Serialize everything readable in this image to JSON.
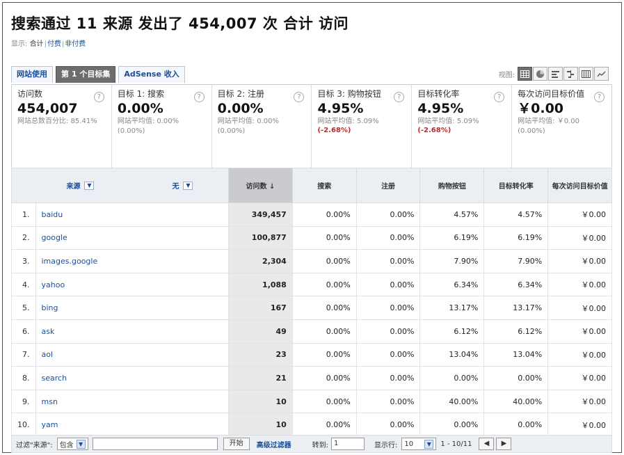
{
  "header": {
    "title": "搜索通过 11 来源 发出了 454,007 次 合计 访问",
    "show_label": "显示:",
    "show_options": [
      "合计",
      "付费",
      "非付费"
    ]
  },
  "tabs": [
    "网站使用",
    "第 1 个目标集",
    "AdSense 收入"
  ],
  "views": {
    "label": "视图:",
    "icons": [
      "table-view-icon",
      "pie-view-icon",
      "performance-view-icon",
      "comparison-view-icon",
      "pivot-view-icon",
      "trend-view-icon"
    ]
  },
  "metrics": [
    {
      "label": "访问数",
      "value": "454,007",
      "sub": "网站总数百分比: 85.41%",
      "neg": ""
    },
    {
      "label": "目标 1: 搜索",
      "value": "0.00%",
      "sub": "网站平均值: 0.00% (0.00%)",
      "neg": ""
    },
    {
      "label": "目标 2: 注册",
      "value": "0.00%",
      "sub": "网站平均值: 0.00% (0.00%)",
      "neg": ""
    },
    {
      "label": "目标 3: 购物按钮",
      "value": "4.95%",
      "sub": "网站平均值: 5.09%",
      "neg": "(-2.68%)"
    },
    {
      "label": "目标转化率",
      "value": "4.95%",
      "sub": "网站平均值: 5.09%",
      "neg": "(-2.68%)"
    },
    {
      "label": "每次访问目标价值",
      "value": "￥0.00",
      "sub": "网站平均值: ￥0.00 (0.00%)",
      "neg": ""
    }
  ],
  "table": {
    "headers": {
      "source": "来源",
      "secondary": "无",
      "visits": "访问数",
      "g1": "搜索",
      "g2": "注册",
      "g3": "购物按钮",
      "conv": "目标转化率",
      "value": "每次访问目标价值"
    },
    "rows": [
      [
        "1.",
        "baidu",
        "349,457",
        "0.00%",
        "0.00%",
        "4.57%",
        "4.57%",
        "￥0.00"
      ],
      [
        "2.",
        "google",
        "100,877",
        "0.00%",
        "0.00%",
        "6.19%",
        "6.19%",
        "￥0.00"
      ],
      [
        "3.",
        "images.google",
        "2,304",
        "0.00%",
        "0.00%",
        "7.90%",
        "7.90%",
        "￥0.00"
      ],
      [
        "4.",
        "yahoo",
        "1,088",
        "0.00%",
        "0.00%",
        "6.34%",
        "6.34%",
        "￥0.00"
      ],
      [
        "5.",
        "bing",
        "167",
        "0.00%",
        "0.00%",
        "13.17%",
        "13.17%",
        "￥0.00"
      ],
      [
        "6.",
        "ask",
        "49",
        "0.00%",
        "0.00%",
        "6.12%",
        "6.12%",
        "￥0.00"
      ],
      [
        "7.",
        "aol",
        "23",
        "0.00%",
        "0.00%",
        "13.04%",
        "13.04%",
        "￥0.00"
      ],
      [
        "8.",
        "search",
        "21",
        "0.00%",
        "0.00%",
        "0.00%",
        "0.00%",
        "￥0.00"
      ],
      [
        "9.",
        "msn",
        "10",
        "0.00%",
        "0.00%",
        "40.00%",
        "40.00%",
        "￥0.00"
      ],
      [
        "10.",
        "yam",
        "10",
        "0.00%",
        "0.00%",
        "0.00%",
        "0.00%",
        "￥0.00"
      ]
    ]
  },
  "footer": {
    "filter_label": "过滤\"来源\":",
    "filter_mode": "包含",
    "filter_value": "",
    "go_label": "开始",
    "advanced_label": "高级过滤器",
    "goto_label": "转到:",
    "goto_value": "1",
    "rows_label": "显示行:",
    "rows_value": "10",
    "range": "1 - 10/11",
    "prev": "◀",
    "next": "▶"
  }
}
